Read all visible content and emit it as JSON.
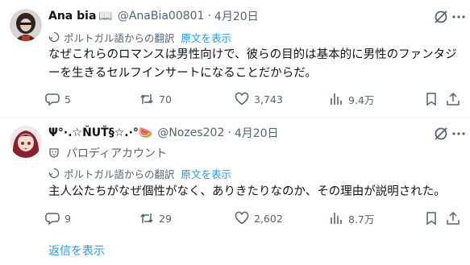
{
  "tweets": [
    {
      "display_name": "Ana bia",
      "name_emoji": "📖",
      "handle": "@AnaBia00801",
      "separator": "·",
      "date": "4月20日",
      "parody_label": "",
      "translated_from": "ポルトガル語からの翻訳",
      "show_original": "原文を表示",
      "text": "なぜこれらのロマンスは男性向けで、彼らの目的は基本的に男性のファンタジーを生きるセルフインサートになることだからだ。",
      "replies": "5",
      "retweets": "70",
      "likes": "3,743",
      "views": "9.4万"
    },
    {
      "display_name": "Ψ°·.☆ŇUŤ§☆.·°🍉",
      "name_emoji": "",
      "handle": "@Nozes202",
      "separator": "·",
      "date": "4月20日",
      "parody_label": "パロディアカウント",
      "translated_from": "ポルトガル語からの翻訳",
      "show_original": "原文を表示",
      "text": "主人公たちがなぜ個性がなく、ありきたりなのか、その理由が説明された。",
      "replies": "9",
      "retweets": "29",
      "likes": "2,602",
      "views": "8.7万"
    }
  ],
  "show_replies": "返信を表示",
  "colors": {
    "accent": "#1d9bf0",
    "secondary_text": "#536471",
    "primary_text": "#0f1419",
    "divider": "#eff3f4"
  },
  "icons": [
    "grok-icon",
    "more-icon",
    "translate-icon",
    "reply-icon",
    "retweet-icon",
    "like-icon",
    "views-icon",
    "bookmark-icon",
    "share-icon",
    "parody-mask-icon"
  ]
}
